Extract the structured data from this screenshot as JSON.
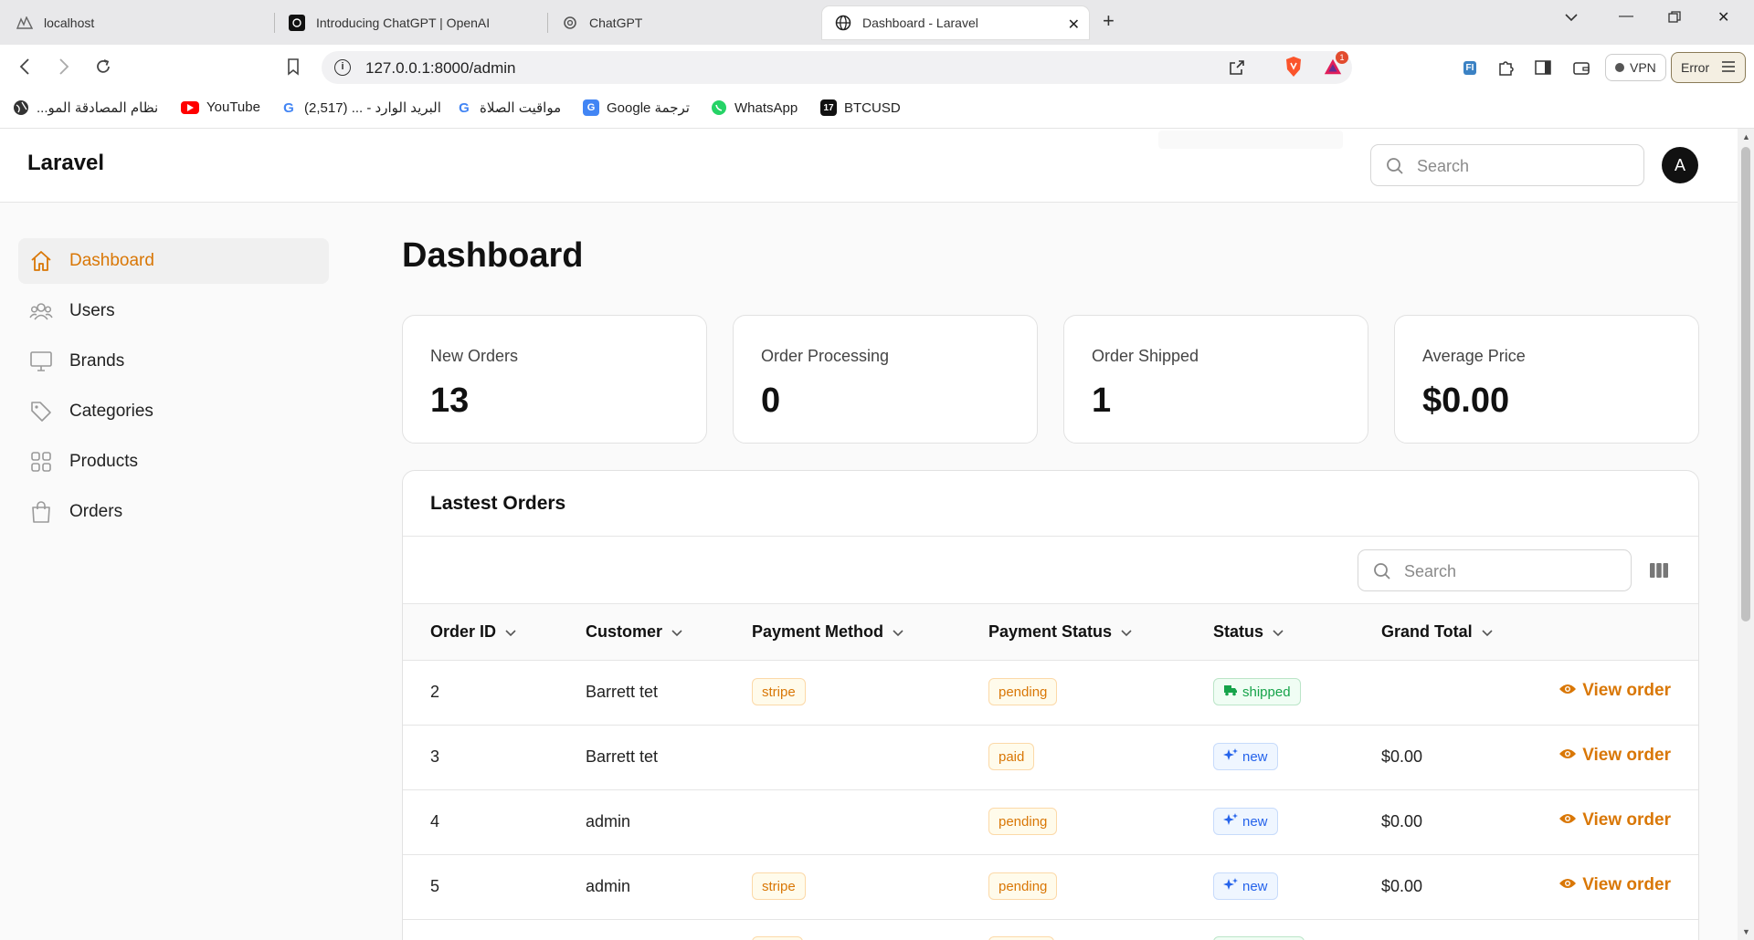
{
  "browser": {
    "tabs": [
      {
        "title": "localhost",
        "icon": "localhost-icon"
      },
      {
        "title": "Introducing ChatGPT | OpenAI",
        "icon": "openai-icon"
      },
      {
        "title": "ChatGPT",
        "icon": "chatgpt-icon"
      },
      {
        "title": "Dashboard - Laravel",
        "icon": "globe-icon",
        "active": true
      }
    ],
    "url": "127.0.0.1:8000/admin",
    "vpn_label": "VPN",
    "error_label": "Error",
    "brave_badge": "1",
    "ext_fi_label": "FI",
    "bookmarks": [
      {
        "label": "نظام المصادقة المو...",
        "icon": "globe-icon"
      },
      {
        "label": "YouTube",
        "icon": "youtube-icon"
      },
      {
        "label": "البريد الوارد - ... (2,517)",
        "icon": "google-icon"
      },
      {
        "label": "مواقيت الصلاة",
        "icon": "google-icon"
      },
      {
        "label": "Google ترجمة",
        "icon": "translate-icon"
      },
      {
        "label": "WhatsApp",
        "icon": "whatsapp-icon"
      },
      {
        "label": "BTCUSD",
        "icon": "tradingview-icon"
      }
    ]
  },
  "app": {
    "brand": "Laravel",
    "search_placeholder": "Search",
    "avatar_initial": "A",
    "accent_color": "#d97706"
  },
  "sidebar": {
    "items": [
      {
        "label": "Dashboard",
        "icon": "home-icon",
        "active": true
      },
      {
        "label": "Users",
        "icon": "users-icon"
      },
      {
        "label": "Brands",
        "icon": "monitor-icon"
      },
      {
        "label": "Categories",
        "icon": "tag-icon"
      },
      {
        "label": "Products",
        "icon": "grid-icon"
      },
      {
        "label": "Orders",
        "icon": "shopping-bag-icon"
      }
    ]
  },
  "main": {
    "title": "Dashboard",
    "stats": [
      {
        "label": "New Orders",
        "value": "13"
      },
      {
        "label": "Order Processing",
        "value": "0"
      },
      {
        "label": "Order Shipped",
        "value": "1"
      },
      {
        "label": "Average Price",
        "value": "$0.00"
      }
    ],
    "orders": {
      "title": "Lastest Orders",
      "search_placeholder": "Search",
      "columns": [
        "Order ID",
        "Customer",
        "Payment Method",
        "Payment Status",
        "Status",
        "Grand Total"
      ],
      "view_label": "View order",
      "rows": [
        {
          "id": "2",
          "customer": "Barrett tet",
          "method": "stripe",
          "payment_status": "pending",
          "status": "shipped",
          "total": ""
        },
        {
          "id": "3",
          "customer": "Barrett tet",
          "method": "",
          "payment_status": "paid",
          "status": "new",
          "total": "$0.00"
        },
        {
          "id": "4",
          "customer": "admin",
          "method": "",
          "payment_status": "pending",
          "status": "new",
          "total": "$0.00"
        },
        {
          "id": "5",
          "customer": "admin",
          "method": "stripe",
          "payment_status": "pending",
          "status": "new",
          "total": "$0.00"
        }
      ]
    }
  }
}
